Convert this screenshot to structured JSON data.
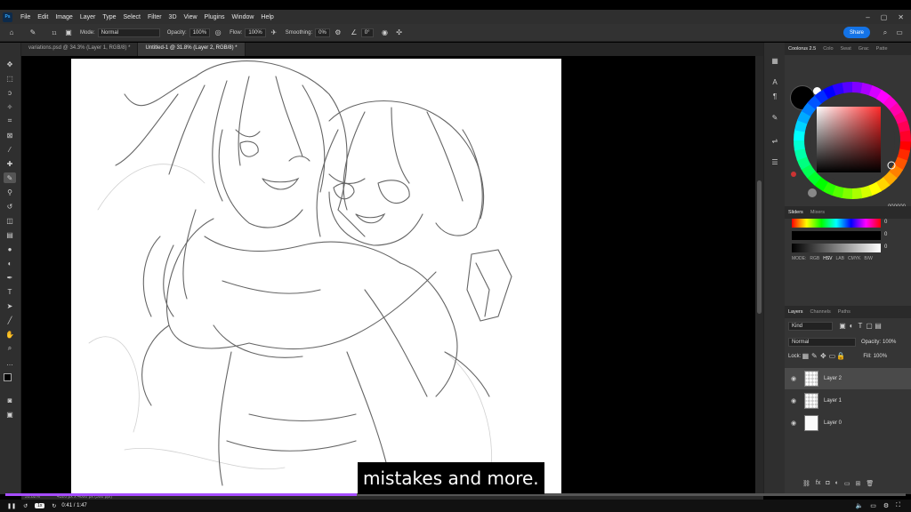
{
  "menu": {
    "app_icon": "Ps",
    "items": [
      "File",
      "Edit",
      "Image",
      "Layer",
      "Type",
      "Select",
      "Filter",
      "3D",
      "View",
      "Plugins",
      "Window",
      "Help"
    ]
  },
  "window_controls": [
    "–",
    "▢",
    "✕"
  ],
  "options": {
    "brush_size": "11",
    "mode_label": "Mode:",
    "mode_value": "Normal",
    "opacity_label": "Opacity:",
    "opacity_value": "100%",
    "flow_label": "Flow:",
    "flow_value": "100%",
    "smoothing_label": "Smoothing:",
    "smoothing_value": "0%",
    "angle_value": "0°",
    "share_label": "Share"
  },
  "tabs": [
    {
      "label": "variations.psd @ 34.3% (Layer 1, RGB/8) *",
      "active": false
    },
    {
      "label": "Untitled-1 @ 31.8% (Layer 2, RGB/8) *",
      "active": true
    }
  ],
  "color_panel": {
    "tabs": [
      "Coolorus 2.5",
      "Colo",
      "Swat",
      "Grac",
      "Patte"
    ],
    "hex": "000000"
  },
  "sliders_panel": {
    "tabs": [
      "Sliders",
      "Mixers"
    ],
    "values": [
      "0",
      "0",
      "0"
    ],
    "modes": [
      "MODE:",
      "RGB",
      "HSV",
      "LAB",
      "CMYK",
      "B/W"
    ],
    "active_mode": "HSV"
  },
  "layers_panel": {
    "tabs": [
      "Layers",
      "Channels",
      "Paths"
    ],
    "kind_label": "Kind",
    "blend_mode": "Normal",
    "opacity_label": "Opacity:",
    "opacity_value": "100%",
    "lock_label": "Lock:",
    "fill_label": "Fill:",
    "fill_value": "100%",
    "layers": [
      {
        "name": "Layer 2",
        "active": true
      },
      {
        "name": "Layer 1",
        "active": false
      },
      {
        "name": "Layer 0",
        "active": false
      }
    ]
  },
  "status": {
    "zoom": "31.82%",
    "doc_size": "4320 px x 4000 px (300 ppi)"
  },
  "player": {
    "speed": "1x",
    "time": "0:41 / 1:47",
    "progress": 0.39
  },
  "caption": "mistakes and more.",
  "colors": {
    "accent": "#1473e6",
    "progress": "#a64dff",
    "panel_bg": "#353535"
  }
}
